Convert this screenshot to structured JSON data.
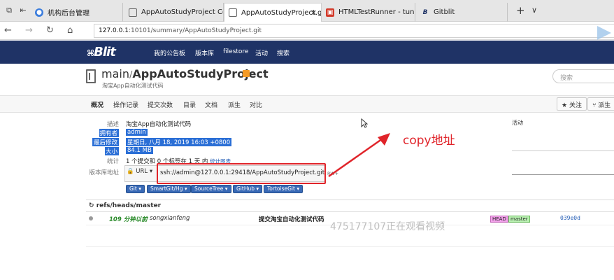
{
  "browser": {
    "tabs": [
      {
        "label": "机构后台管理"
      },
      {
        "label": "AppAutoStudyProject Confi"
      },
      {
        "label": "AppAutoStudyProject.g"
      },
      {
        "label": "HTMLTestRunner - tungwai"
      },
      {
        "label": "Gitblit"
      }
    ],
    "url_host": "127.0.0.1",
    "url_rest": ":10101/summary/AppAutoStudyProject.git"
  },
  "topnav": {
    "logo": "Blit",
    "items": [
      "我的公告板",
      "版本库",
      "filestore",
      "活动",
      "搜索"
    ]
  },
  "repo": {
    "owner_link": "main",
    "separator": "/",
    "name": "AppAutoStudyProject",
    "description": "淘宝App自动化测试代码",
    "search_placeholder": "搜索"
  },
  "subnav": {
    "items": [
      "概况",
      "操作记录",
      "提交次数",
      "目录",
      "文档",
      "派生",
      "对比"
    ],
    "watch": "关注",
    "fork": "派生"
  },
  "summary": {
    "desc_label": "描述",
    "desc_value": "淘宝App自动化测试代码",
    "owner_label": "拥有者",
    "owner_value": "admin",
    "modified_label": "最后修改",
    "modified_value": "星期日, 八月 18, 2019 16:03 +0800",
    "size_label": "大小",
    "size_value": "84.1 MB",
    "stats_label": "统计",
    "stats_value": "1 个提交和 0 个标签在 1 天 内",
    "stats_link": "统计图表",
    "url_label": "版本库地址",
    "url_btn": "URL",
    "clone_url": "ssh://admin@127.0.0.1:29418/AppAutoStudyProject.git",
    "rw": "RW+",
    "clients": [
      "Git",
      "SmartGit/Hg",
      "SourceTree",
      "GitHub",
      "TortoiseGit"
    ]
  },
  "annotation": "copy地址",
  "activity_label": "活动",
  "refs": {
    "header": "refs/heads/master",
    "rows": [
      {
        "age": "109 分钟以前",
        "author": "songxianfeng",
        "message": "提交淘宝自动化测试代码",
        "tag_head": "HEAD",
        "tag_branch": "master",
        "sha": "039e0d"
      }
    ]
  },
  "watermark": "475177107正在观看视频"
}
